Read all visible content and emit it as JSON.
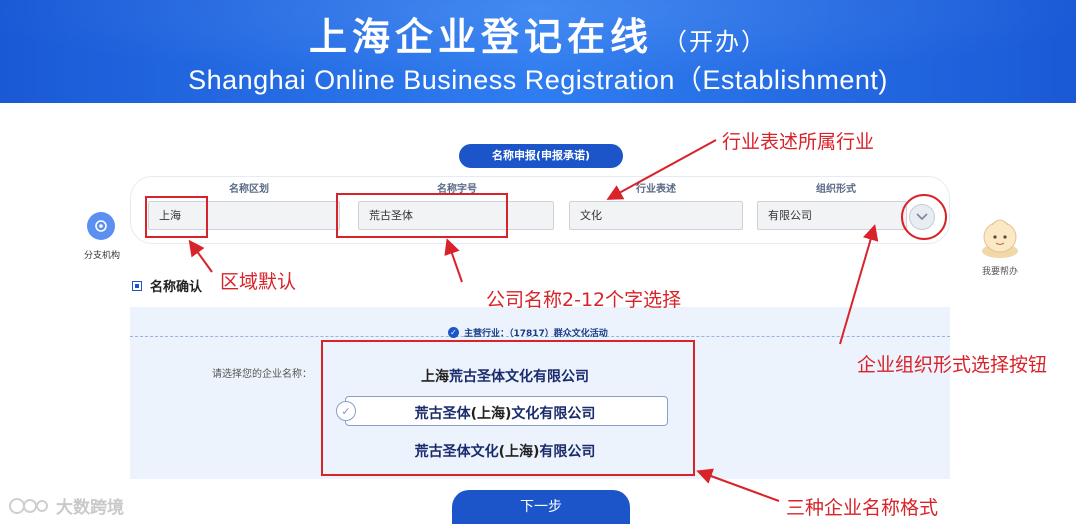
{
  "header": {
    "title_cn": "上海企业登记在线",
    "title_suffix": "（开办）",
    "title_en": "Shanghai Online Business Registration（Establishment)"
  },
  "tab": {
    "label": "名称申报(申报承诺)"
  },
  "form": {
    "columns": [
      {
        "label": "名称区划",
        "value": "上海"
      },
      {
        "label": "名称字号",
        "value": "荒古圣体"
      },
      {
        "label": "行业表述",
        "value": "文化"
      },
      {
        "label": "组织形式",
        "value": "有限公司"
      }
    ]
  },
  "side": {
    "branch_label": "分支机构",
    "help_label": "我要帮办"
  },
  "section": {
    "title": "名称确认",
    "industry": "主营行业：（17817）群众文化活动",
    "prompt": "请选择您的企业名称："
  },
  "options": [
    {
      "prefix": "上海",
      "rest": "荒古圣体文化有限公司",
      "selected": false
    },
    {
      "a": "荒古圣体",
      "b": "(上海)",
      "c": "文化有限公司",
      "selected": true
    },
    {
      "a": "荒古圣体文化",
      "b": "(上海)",
      "c": "有限公司",
      "selected": false
    }
  ],
  "next_button": "下一步",
  "annotations": {
    "industry_note": "行业表述所属行业",
    "region_note": "区域默认",
    "name_note": "公司名称2-12个字选择",
    "org_note": "企业组织形式选择按钮",
    "format_note": "三种企业名称格式"
  },
  "watermark": "大数跨境",
  "colors": {
    "brand_blue": "#1b55c9",
    "annotation_red": "#d8232a"
  }
}
